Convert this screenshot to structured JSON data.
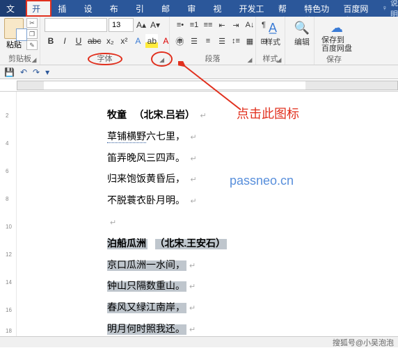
{
  "tabs": {
    "file": "文件",
    "home": "开始",
    "insert": "插入",
    "design": "设计",
    "layout": "布局",
    "references": "引用",
    "mailings": "邮件",
    "review": "审阅",
    "view": "视图",
    "devtools": "开发工具",
    "help": "帮助",
    "featured": "特色功能",
    "baidu": "百度网盘",
    "tell_me": "操作说明搜索"
  },
  "ribbon": {
    "clipboard": {
      "label": "剪贴板",
      "paste": "粘贴"
    },
    "font": {
      "label": "字体",
      "size": "13",
      "bold": "B",
      "italic": "I",
      "under": "U",
      "strike": "abc",
      "sub": "x₂",
      "sup": "x²"
    },
    "paragraph": {
      "label": "段落"
    },
    "styles": {
      "label": "样式",
      "btn": "样式"
    },
    "editing": {
      "label": "编辑",
      "btn": "编辑"
    },
    "save": {
      "label": "保存",
      "btn": "保存到\n百度网盘"
    }
  },
  "annotation": "点击此图标",
  "watermark": "passneo.cn",
  "poem1": {
    "title1": "牧童",
    "title2": "（北宋.吕岩）",
    "l1a": "草铺横野",
    "l1b": "六七里，",
    "l2": "笛弄晚风三四声。",
    "l3": "归来饱饭黄昏后，",
    "l4": "不脱蓑衣卧月明。"
  },
  "poem2": {
    "title1": "泊船瓜洲",
    "title2": "（北宋.王安石）",
    "l1": "京口瓜洲一水间，",
    "l2": "钟山只隔数重山。",
    "l3": "春风又绿江南岸，",
    "l4": "明月何时照我还。"
  },
  "footer_credit": "搜狐号@小吴泡泡"
}
